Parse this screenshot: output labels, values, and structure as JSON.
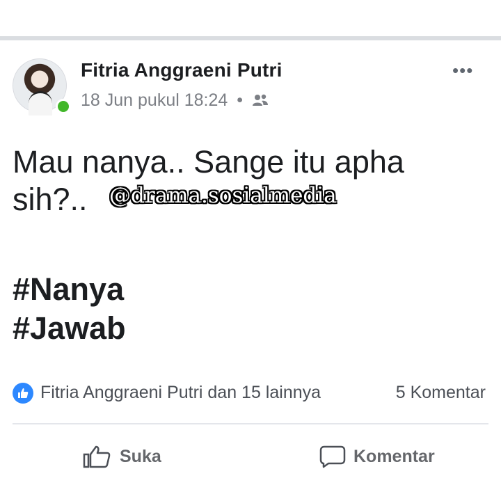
{
  "post": {
    "author": "Fitria Anggraeni Putri",
    "timestamp": "18 Jun pukul 18:24",
    "separator": "•",
    "audience_icon": "friends-icon",
    "more_menu": "•••",
    "body": "Mau nanya.. Sange itu apha sih?..",
    "hashtags": [
      "#Nanya",
      "#Jawab"
    ]
  },
  "watermark": "@drama.sosialmedia",
  "reactions": {
    "icon": "like-icon",
    "text": "Fitria Anggraeni Putri dan 15 lainnya",
    "comments": "5 Komentar"
  },
  "actions": {
    "like_label": "Suka",
    "comment_label": "Komentar"
  },
  "colors": {
    "like_blue": "#2d88ff",
    "online_green": "#42b72a",
    "meta_gray": "#7c7f85"
  }
}
